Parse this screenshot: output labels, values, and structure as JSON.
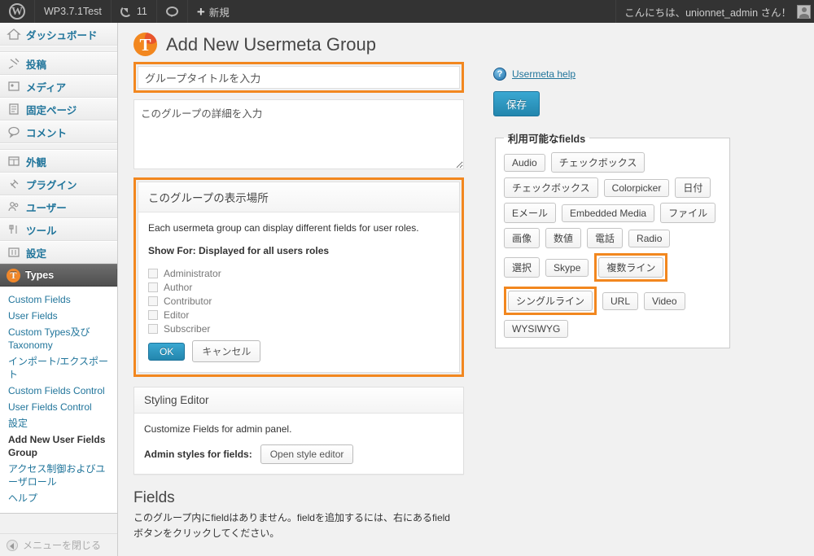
{
  "adminbar": {
    "logo_icon": "wordpress-logo-icon",
    "site_name": "WP3.7.1Test",
    "updates_icon": "refresh-icon",
    "updates_count": "11",
    "comments_icon": "comment-bubble-icon",
    "new_icon": "plus-icon",
    "new_label": "新規",
    "greeting": "こんにちは、unionnet_admin さん！",
    "avatar_icon": "avatar-icon"
  },
  "sidebar": {
    "items": [
      {
        "label": "ダッシュボード",
        "icon": "dashboard-home-icon"
      },
      {
        "label": "投稿",
        "icon": "pin-icon"
      },
      {
        "label": "メディア",
        "icon": "media-icon"
      },
      {
        "label": "固定ページ",
        "icon": "page-icon"
      },
      {
        "label": "コメント",
        "icon": "comment-icon"
      },
      {
        "label": "外観",
        "icon": "appearance-icon"
      },
      {
        "label": "プラグイン",
        "icon": "plugin-plug-icon"
      },
      {
        "label": "ユーザー",
        "icon": "users-icon"
      },
      {
        "label": "ツール",
        "icon": "tools-icon"
      },
      {
        "label": "設定",
        "icon": "settings-gear-icon"
      },
      {
        "label": "Types",
        "icon": "types-logo-icon",
        "current": true
      }
    ],
    "submenu": [
      {
        "label": "Custom Fields"
      },
      {
        "label": "User Fields"
      },
      {
        "label": "Custom Types及びTaxonomy"
      },
      {
        "label": "インポート/エクスポート"
      },
      {
        "label": "Custom Fields Control"
      },
      {
        "label": "User Fields Control"
      },
      {
        "label": "設定"
      },
      {
        "label": "Add New User Fields Group",
        "current": true
      },
      {
        "label": "アクセス制御およびユーザロール"
      },
      {
        "label": "ヘルプ"
      }
    ],
    "collapse_label": "メニューを閉じる",
    "collapse_icon": "collapse-arrow-icon"
  },
  "page": {
    "logo_icon": "types-logo-icon",
    "title": "Add New Usermeta Group"
  },
  "form": {
    "title_value": "グループタイトルを入力",
    "title_placeholder": "グループタイトルを入力",
    "description_value": "このグループの詳細を入力",
    "description_placeholder": "このグループの詳細を入力"
  },
  "display_box": {
    "heading": "このグループの表示場所",
    "intro": "Each usermeta group can display different fields for user roles.",
    "show_for": "Show For: Displayed for all users roles",
    "roles": [
      {
        "label": "Administrator",
        "checked": false
      },
      {
        "label": "Author",
        "checked": false
      },
      {
        "label": "Contributor",
        "checked": false
      },
      {
        "label": "Editor",
        "checked": false
      },
      {
        "label": "Subscriber",
        "checked": false
      }
    ],
    "ok_label": "OK",
    "cancel_label": "キャンセル"
  },
  "styling_box": {
    "heading": "Styling Editor",
    "intro": "Customize Fields for admin panel.",
    "label": "Admin styles for fields:",
    "button_label": "Open style editor"
  },
  "fields_section": {
    "title": "Fields",
    "description": "このグループ内にfieldはありません。fieldを追加するには、右にあるfieldボタンをクリックしてください。"
  },
  "right": {
    "help_icon": "question-mark-help-icon",
    "help_label": "Usermeta help",
    "save_label": "保存",
    "fields_legend": "利用可能なfields",
    "field_rows": [
      [
        {
          "label": "Audio"
        },
        {
          "label": "チェックボックス"
        }
      ],
      [
        {
          "label": "チェックボックス"
        },
        {
          "label": "Colorpicker"
        },
        {
          "label": "日付"
        }
      ],
      [
        {
          "label": "Eメール"
        },
        {
          "label": "Embedded Media"
        },
        {
          "label": "ファイル"
        }
      ],
      [
        {
          "label": "画像"
        },
        {
          "label": "数値"
        },
        {
          "label": "電話"
        },
        {
          "label": "Radio"
        }
      ],
      [
        {
          "label": "選択"
        },
        {
          "label": "Skype"
        },
        {
          "label": "複数ライン",
          "highlighted": true
        }
      ],
      [
        {
          "label": "シングルライン",
          "highlighted": true
        },
        {
          "label": "URL"
        },
        {
          "label": "Video"
        }
      ],
      [
        {
          "label": "WYSIWYG"
        }
      ]
    ]
  },
  "colors": {
    "highlight_orange": "#f2871f",
    "accent_blue": "#2386ad",
    "link_blue": "#21759b",
    "adminbar_dark": "#333333"
  }
}
